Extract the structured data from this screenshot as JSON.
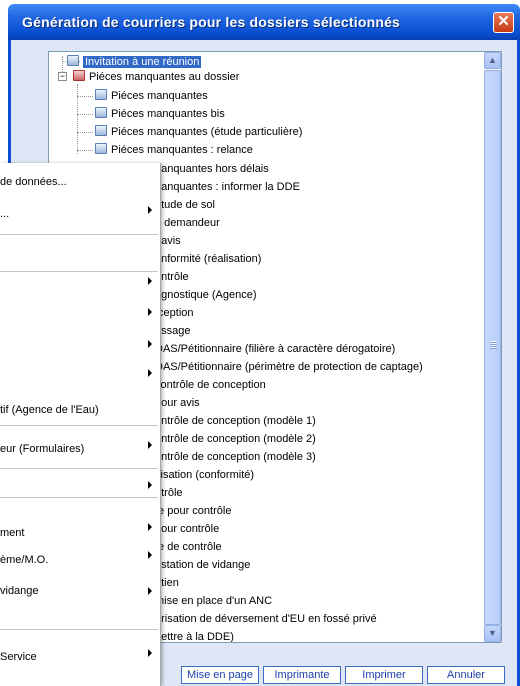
{
  "window": {
    "title": "Génération de courriers pour les dossiers sélectionnés",
    "close_label": "✕"
  },
  "tree": {
    "root_selected": "Invitation à une réunion",
    "folder": "Piéces manquantes au dossier",
    "children": [
      "Piéces manquantes",
      "Piéces manquantes bis",
      "Piéces manquantes (étude particulière)",
      "Piéces manquantes : relance"
    ],
    "partial_items": [
      "nanquantes hors délais",
      "nanquantes : informer la DDE",
      "étude de sol",
      "u demandeur",
      "t avis",
      "onformité (réalisation)",
      "ontrôle",
      "agnostique (Agence)",
      "ıception",
      "assage",
      "DAS/Pétitionnaire (filière à caractère dérogatoire)",
      "DAS/Pétitionnaire (périmètre de protection de captage)",
      " contrôle de conception",
      "oour avis",
      "ontrôle de conception (modèle 1)",
      "ontrôle de conception (modèle 2)",
      "ontrôle de conception (modèle 3)",
      "ılisation (conformité)",
      "ntrôle",
      ":e pour contrôle",
      "oour contrôle",
      ":e de contrôle",
      "estation de vidange",
      "etien",
      "mise en place d'un ANC",
      "orisation de déversement d'EU en fossé privé",
      "(lettre à la DDE)"
    ]
  },
  "menu": {
    "items": [
      "de données...",
      "...",
      "tif (Agence de l'Eau)",
      "eur (Formulaires)",
      "ment",
      "ème/M.O.",
      "vidange",
      "Service"
    ]
  },
  "buttons": {
    "page_setup": "Mise en page",
    "printer": "Imprimante",
    "print": "Imprimer",
    "cancel": "Annuler"
  }
}
